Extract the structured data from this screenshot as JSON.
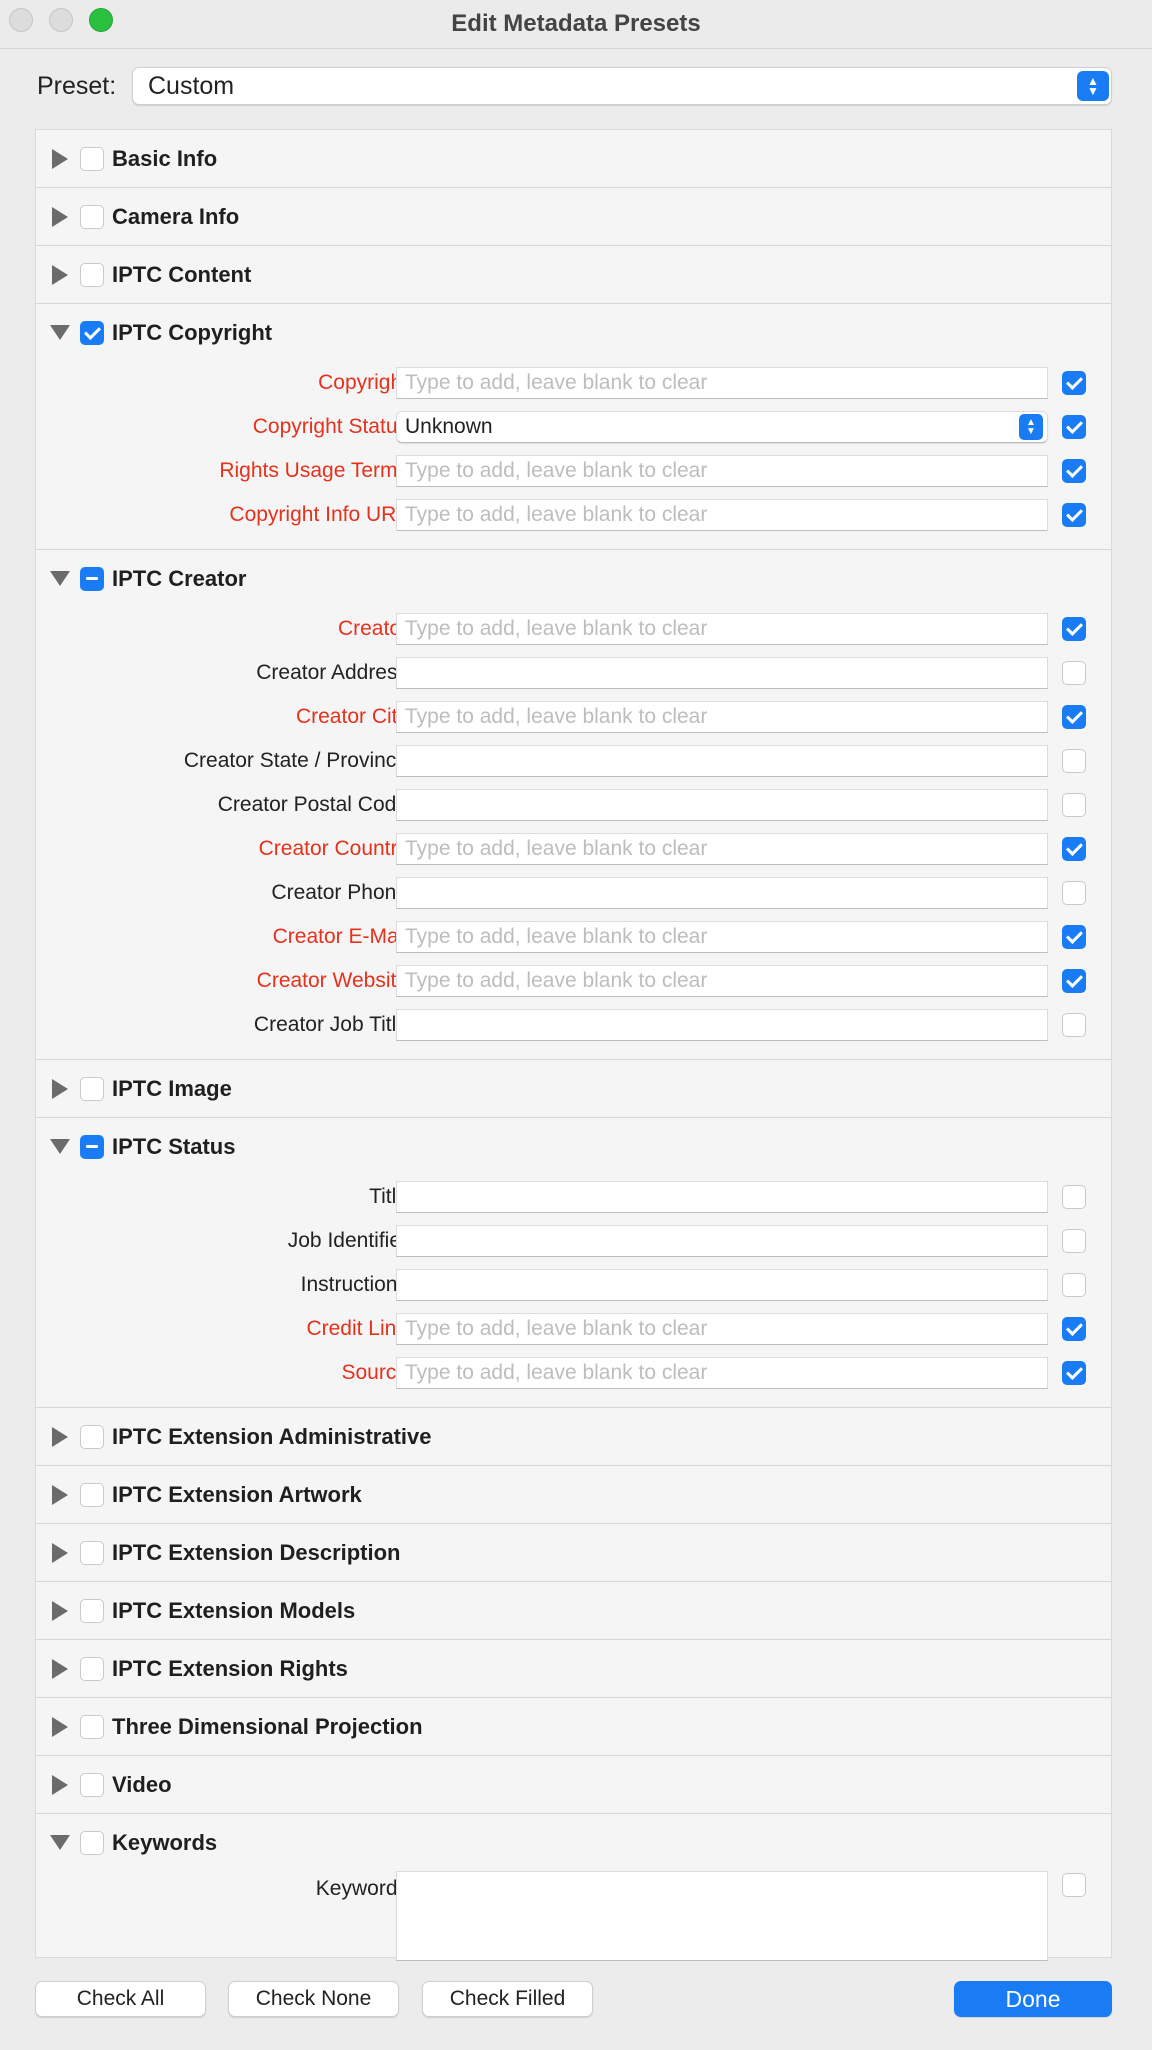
{
  "window": {
    "title": "Edit Metadata Presets"
  },
  "preset": {
    "label": "Preset:",
    "value": "Custom"
  },
  "placeholder": "Type to add, leave blank to clear",
  "sections": [
    {
      "title": "Basic Info",
      "expanded": false,
      "state": "unchecked",
      "rows": []
    },
    {
      "title": "Camera Info",
      "expanded": false,
      "state": "unchecked",
      "rows": []
    },
    {
      "title": "IPTC Content",
      "expanded": false,
      "state": "unchecked",
      "rows": []
    },
    {
      "title": "IPTC Copyright",
      "expanded": true,
      "state": "checked",
      "rows": [
        {
          "label": "Copyright",
          "type": "text",
          "value": "",
          "checked": true
        },
        {
          "label": "Copyright Status",
          "type": "select",
          "value": "Unknown",
          "checked": true
        },
        {
          "label": "Rights Usage Terms",
          "type": "text",
          "value": "",
          "checked": true
        },
        {
          "label": "Copyright Info URL",
          "type": "text",
          "value": "",
          "checked": true
        }
      ]
    },
    {
      "title": "IPTC Creator",
      "expanded": true,
      "state": "mixed",
      "rows": [
        {
          "label": "Creator",
          "type": "text",
          "value": "",
          "checked": true
        },
        {
          "label": "Creator Address",
          "type": "text",
          "value": "",
          "checked": false
        },
        {
          "label": "Creator City",
          "type": "text",
          "value": "",
          "checked": true
        },
        {
          "label": "Creator State / Province",
          "type": "text",
          "value": "",
          "checked": false
        },
        {
          "label": "Creator Postal Code",
          "type": "text",
          "value": "",
          "checked": false
        },
        {
          "label": "Creator Country",
          "type": "text",
          "value": "",
          "checked": true
        },
        {
          "label": "Creator Phone",
          "type": "text",
          "value": "",
          "checked": false
        },
        {
          "label": "Creator E-Mail",
          "type": "text",
          "value": "",
          "checked": true
        },
        {
          "label": "Creator Website",
          "type": "text",
          "value": "",
          "checked": true
        },
        {
          "label": "Creator Job Title",
          "type": "text",
          "value": "",
          "checked": false
        }
      ]
    },
    {
      "title": "IPTC Image",
      "expanded": false,
      "state": "unchecked",
      "rows": []
    },
    {
      "title": "IPTC Status",
      "expanded": true,
      "state": "mixed",
      "rows": [
        {
          "label": "Title",
          "type": "text",
          "value": "",
          "checked": false
        },
        {
          "label": "Job Identifier",
          "type": "text",
          "value": "",
          "checked": false
        },
        {
          "label": "Instructions",
          "type": "text",
          "value": "",
          "checked": false
        },
        {
          "label": "Credit Line",
          "type": "text",
          "value": "",
          "checked": true
        },
        {
          "label": "Source",
          "type": "text",
          "value": "",
          "checked": true
        }
      ]
    },
    {
      "title": "IPTC Extension Administrative",
      "expanded": false,
      "state": "unchecked",
      "rows": []
    },
    {
      "title": "IPTC Extension Artwork",
      "expanded": false,
      "state": "unchecked",
      "rows": []
    },
    {
      "title": "IPTC Extension Description",
      "expanded": false,
      "state": "unchecked",
      "rows": []
    },
    {
      "title": "IPTC Extension Models",
      "expanded": false,
      "state": "unchecked",
      "rows": []
    },
    {
      "title": "IPTC Extension Rights",
      "expanded": false,
      "state": "unchecked",
      "rows": []
    },
    {
      "title": "Three Dimensional Projection",
      "expanded": false,
      "state": "unchecked",
      "rows": []
    },
    {
      "title": "Video",
      "expanded": false,
      "state": "unchecked",
      "rows": []
    },
    {
      "title": "Keywords",
      "expanded": true,
      "state": "unchecked",
      "rows": [
        {
          "label": "Keywords",
          "type": "textarea",
          "value": "",
          "checked": false
        }
      ]
    }
  ],
  "buttons": {
    "check_all": "Check All",
    "check_none": "Check None",
    "check_filled": "Check Filled",
    "done": "Done"
  },
  "colors": {
    "accent": "#1a7cf5",
    "checked_label": "#e5321c"
  }
}
